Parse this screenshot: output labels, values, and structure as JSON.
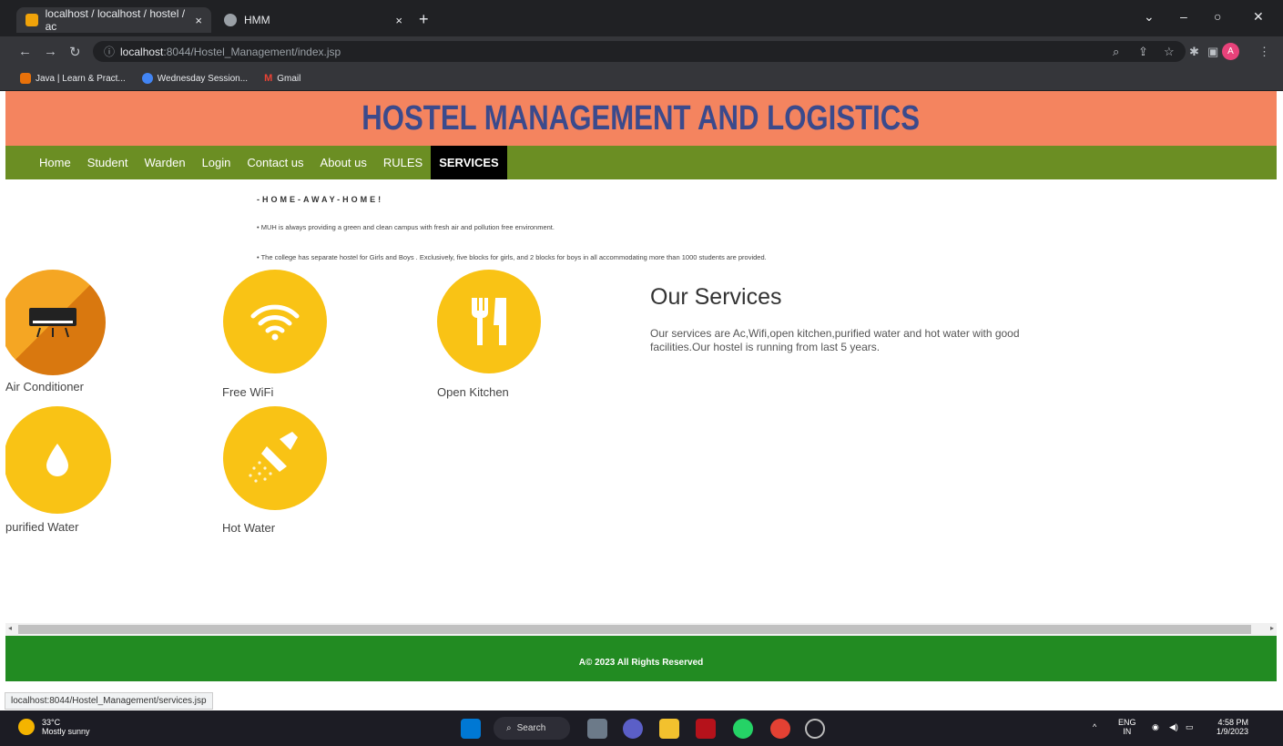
{
  "browser": {
    "tabs": [
      {
        "title": "localhost / localhost / hostel / ac",
        "close": "×"
      },
      {
        "title": "HMM",
        "close": "×"
      }
    ],
    "new_tab": "+",
    "window_controls": {
      "collapse": "⌄",
      "minimize": "–",
      "maximize": "○",
      "close": "✕"
    },
    "url_host": "localhost",
    "url_path": ":8044/Hostel_Management/index.jsp",
    "bookmarks": [
      {
        "label": "Java | Learn & Pract...",
        "color": "#e8710a"
      },
      {
        "label": "Wednesday Session...",
        "color": "#4285f4"
      },
      {
        "label": "Gmail",
        "color": "#ea4335"
      }
    ],
    "avatar_initial": "A"
  },
  "site": {
    "title": "HOSTEL MANAGEMENT AND LOGISTICS",
    "menu": [
      "Home",
      "Student",
      "Warden",
      "Login",
      "Contact us",
      "About us",
      "RULES",
      "SERVICES"
    ],
    "tagline": "-HOME-AWAY-HOME!",
    "info_line1": "• MUH is always providing a green and clean campus with fresh air and pollution free environment.",
    "info_line2": "• The college has separate hostel for Girls and Boys . Exclusively, five blocks for girls, and 2 blocks for boys in all accommodating more than 1000 students are provided.",
    "services": [
      {
        "name": "Air Conditioner",
        "icon": "air-conditioner-icon",
        "color": "#f0911a"
      },
      {
        "name": "Free WiFi",
        "icon": "wifi-icon",
        "color": "#f9c315"
      },
      {
        "name": "Open Kitchen",
        "icon": "kitchen-icon",
        "color": "#f9c315"
      },
      {
        "name": "purified Water",
        "icon": "water-drop-icon",
        "color": "#f9c315"
      },
      {
        "name": "Hot Water",
        "icon": "shower-icon",
        "color": "#f9c315"
      }
    ],
    "our_services_title": "Our Services",
    "our_services_desc": "Our services are Ac,Wifi,open kitchen,purified water and hot water with good facilities.Our hostel is running from last 5 years.",
    "footer": "A© 2023 All Rights Reserved"
  },
  "status_url": "localhost:8044/Hostel_Management/services.jsp",
  "taskbar": {
    "temp": "33°C",
    "weather": "Mostly sunny",
    "search": "Search",
    "lang": "ENG",
    "region": "IN",
    "time": "4:58 PM",
    "date": "1/9/2023"
  }
}
